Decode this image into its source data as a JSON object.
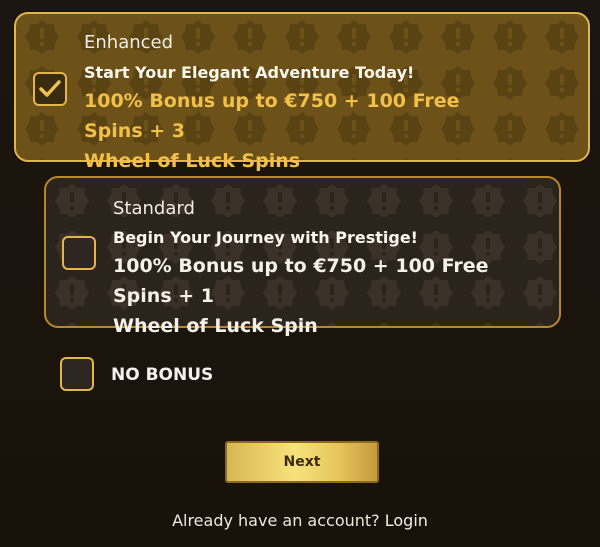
{
  "options": {
    "enhanced": {
      "tier": "Enhanced",
      "tagline": "Start Your Elegant Adventure Today!",
      "offer_line1": "100% Bonus up to €750 + 100 Free Spins + 3",
      "offer_line2": "Wheel of Luck Spins",
      "checked": true
    },
    "standard": {
      "tier": "Standard",
      "tagline": "Begin Your Journey with Prestige!",
      "offer_line1": "100% Bonus up to €750 + 100 Free Spins + 1",
      "offer_line2": "Wheel of Luck Spin",
      "checked": false
    },
    "no_bonus": {
      "label": "NO BONUS",
      "checked": false
    }
  },
  "next_button": {
    "label": "Next"
  },
  "login": {
    "prompt": "Already have an account?",
    "link": "Login"
  },
  "icons": {
    "checkmark": "checkmark-icon",
    "pattern": "alert-badge-icon"
  },
  "colors": {
    "accent_gold": "#e5b54a",
    "offer_gold": "#f2bf48",
    "enhanced_bg": "#6c5218",
    "standard_bg": "#2b241d",
    "page_bg": "#1a140d"
  }
}
